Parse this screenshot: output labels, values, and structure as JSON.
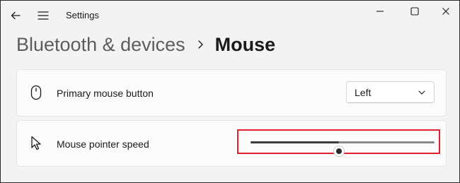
{
  "window": {
    "app_title": "Settings",
    "icons": {
      "back": "back-arrow-icon",
      "menu": "hamburger-menu-icon",
      "minimize": "minimize-icon",
      "maximize": "maximize-icon",
      "close": "close-icon"
    }
  },
  "breadcrumb": {
    "parent": "Bluetooth & devices",
    "separator_icon": "chevron-right-icon",
    "current": "Mouse"
  },
  "settings": {
    "primary_button": {
      "icon": "mouse-icon",
      "label": "Primary mouse button",
      "value": "Left",
      "dropdown_icon": "chevron-down-icon"
    },
    "pointer_speed": {
      "icon": "mouse-pointer-icon",
      "label": "Mouse pointer speed",
      "slider_fraction": 0.48,
      "highlight_color": "#e0202b"
    }
  }
}
